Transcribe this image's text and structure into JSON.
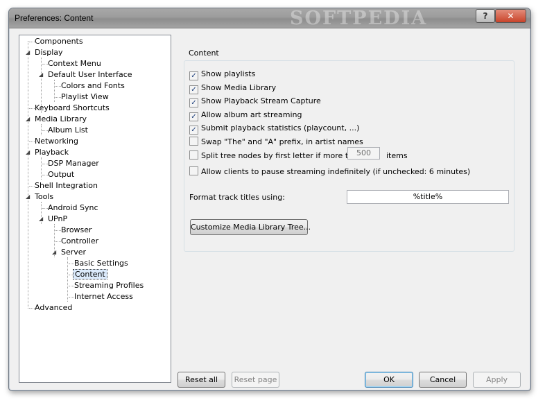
{
  "window": {
    "title": "Preferences: Content",
    "watermark": "SOFTPEDIA",
    "help_glyph": "?",
    "close_glyph": "✕"
  },
  "tree": {
    "items": [
      {
        "label": "Components"
      },
      {
        "label": "Display"
      },
      {
        "label": "Context Menu"
      },
      {
        "label": "Default User Interface"
      },
      {
        "label": "Colors and Fonts"
      },
      {
        "label": "Playlist View"
      },
      {
        "label": "Keyboard Shortcuts"
      },
      {
        "label": "Media Library"
      },
      {
        "label": "Album List"
      },
      {
        "label": "Networking"
      },
      {
        "label": "Playback"
      },
      {
        "label": "DSP Manager"
      },
      {
        "label": "Output"
      },
      {
        "label": "Shell Integration"
      },
      {
        "label": "Tools"
      },
      {
        "label": "Android Sync"
      },
      {
        "label": "UPnP"
      },
      {
        "label": "Browser"
      },
      {
        "label": "Controller"
      },
      {
        "label": "Server"
      },
      {
        "label": "Basic Settings"
      },
      {
        "label": "Content",
        "selected": true
      },
      {
        "label": "Streaming Profiles"
      },
      {
        "label": "Internet Access"
      },
      {
        "label": "Advanced"
      }
    ]
  },
  "content": {
    "group_title": "Content",
    "options": [
      {
        "label": "Show playlists",
        "checked": true
      },
      {
        "label": "Show Media Library",
        "checked": true
      },
      {
        "label": "Show Playback Stream Capture",
        "checked": true
      },
      {
        "label": "Allow album art streaming",
        "checked": true
      },
      {
        "label": "Submit playback statistics (playcount, ...)",
        "checked": true
      },
      {
        "label": "Swap \"The\" and \"A\" prefix, in artist names",
        "checked": false
      },
      {
        "label": "Split tree nodes by first letter if more than",
        "checked": false
      },
      {
        "label": "Allow clients to pause streaming indefinitely (if unchecked: 6 minutes)",
        "checked": false
      }
    ],
    "split_value": "500",
    "split_suffix": "items",
    "format_label": "Format track titles using:",
    "format_value": "%title%",
    "customize_button": "Customize Media Library Tree..."
  },
  "footer": {
    "reset_all": "Reset all",
    "reset_page": "Reset page",
    "ok": "OK",
    "cancel": "Cancel",
    "apply": "Apply"
  }
}
